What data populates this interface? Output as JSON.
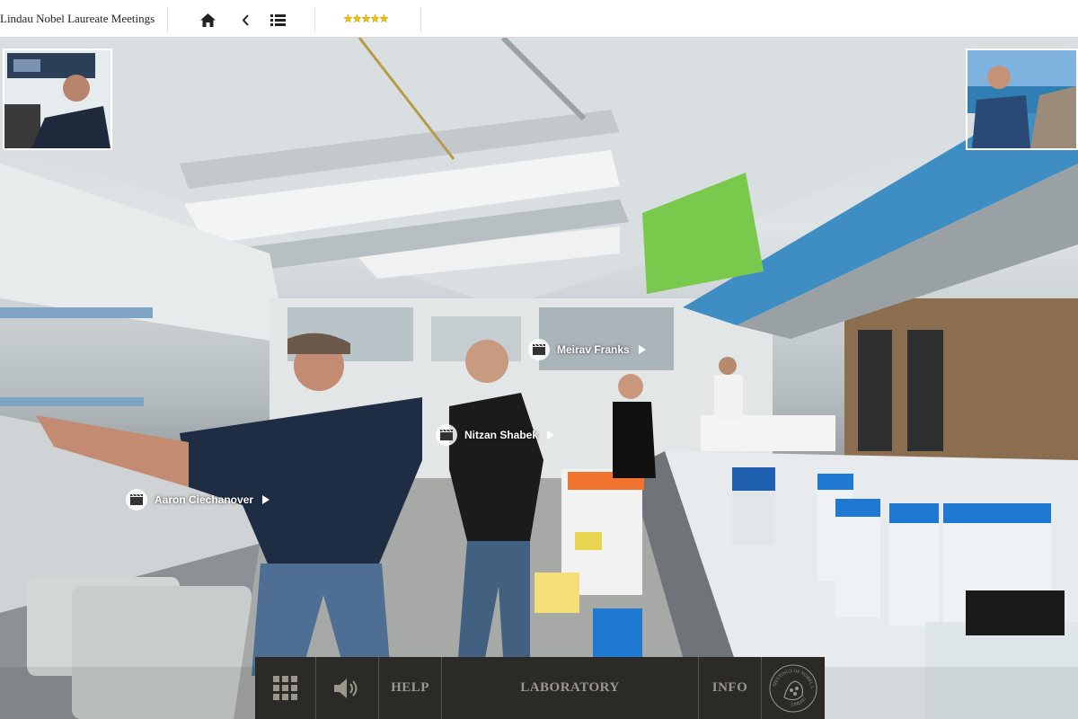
{
  "header": {
    "site_title": "Lindau Nobel Laureate Meetings",
    "rating_stars": 5
  },
  "hotspots": [
    {
      "label": "Meirav Franks"
    },
    {
      "label": "Nitzan Shabek"
    },
    {
      "label": "Aaron Ciechanover"
    }
  ],
  "bottom_nav": {
    "help_label": "HELP",
    "scene_label": "LABORATORY",
    "info_label": "INFO",
    "logo_text": "MEETINGS OF NOBEL LAUREATES LINDAU"
  },
  "colors": {
    "star": "#f2c200",
    "bottom_bar": "#2b2a26",
    "bottom_text": "#9c978c"
  }
}
